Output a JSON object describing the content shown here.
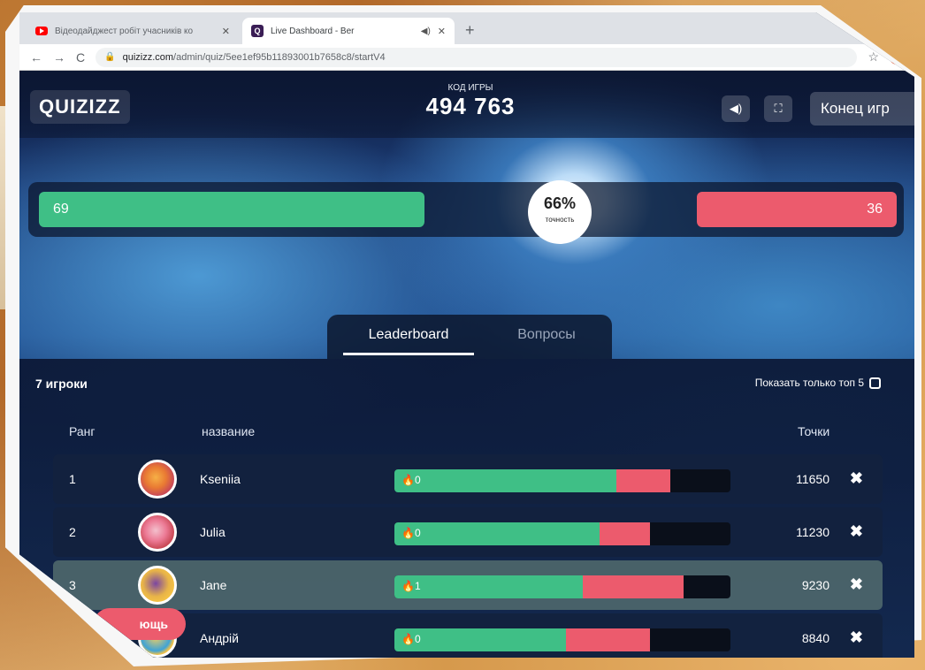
{
  "browser": {
    "tabs": [
      {
        "title": "Відеодайджест робіт учасників ко",
        "icon": "youtube-icon"
      },
      {
        "title": "Live Dashboard - Ber",
        "icon": "quizizz-icon"
      }
    ],
    "new_tab": "+",
    "url_domain": "quizizz.com",
    "url_path": "/admin/quiz/5ee1ef95b11893001b7658c8/startV4"
  },
  "header": {
    "logo": "QUIZIZZ",
    "code_label": "КОД ИГРЫ",
    "code_value": "494 763",
    "end_button": "Конец игр"
  },
  "accuracy": {
    "correct": "69",
    "incorrect": "36",
    "percent": "66%",
    "label": "точность",
    "correct_fraction": 0.66
  },
  "tabs": {
    "leaderboard": "Leaderboard",
    "questions": "Вопросы"
  },
  "board": {
    "players_count": "7 игроки",
    "show_top5": "Показать только топ 5",
    "col_rank": "Ранг",
    "col_name": "название",
    "col_points": "Точки"
  },
  "players": [
    {
      "rank": "1",
      "name": "Kseniia",
      "streak": "0",
      "points": "11650",
      "correct": 0.66,
      "incorrect": 0.16
    },
    {
      "rank": "2",
      "name": "Julia",
      "streak": "0",
      "points": "11230",
      "correct": 0.61,
      "incorrect": 0.15
    },
    {
      "rank": "3",
      "name": "Jane",
      "streak": "1",
      "points": "9230",
      "correct": 0.56,
      "incorrect": 0.3
    },
    {
      "rank": "",
      "name": "Андрій",
      "streak": "0",
      "points": "8840",
      "correct": 0.51,
      "incorrect": 0.25
    }
  ],
  "help_button": "ющь",
  "colors": {
    "correct": "#3fbf86",
    "incorrect": "#ec5b6d"
  }
}
